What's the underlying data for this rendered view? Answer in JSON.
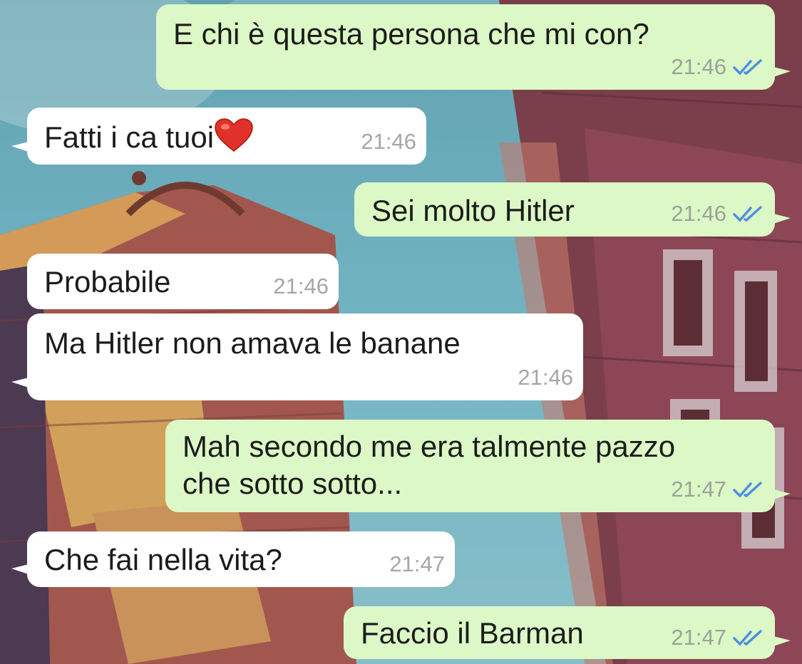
{
  "chat": {
    "messages": [
      {
        "direction": "out",
        "text": "E chi è questa persona che mi con?",
        "time": "21:46",
        "status": "read"
      },
      {
        "direction": "in",
        "text": "Fatti i ca tuoi",
        "emoji": "heart-emoji",
        "time": "21:46"
      },
      {
        "direction": "out",
        "text": "Sei molto Hitler",
        "time": "21:46",
        "status": "read"
      },
      {
        "direction": "in",
        "text": "Probabile",
        "time": "21:46"
      },
      {
        "direction": "in",
        "text": "Ma Hitler non amava le banane",
        "time": "21:46"
      },
      {
        "direction": "out",
        "text": "Mah secondo me era talmente pazzo\nche sotto sotto...",
        "time": "21:47",
        "status": "read"
      },
      {
        "direction": "in",
        "text": "Che fai nella vita?",
        "time": "21:47"
      },
      {
        "direction": "out",
        "text": "Faccio il Barman",
        "time": "21:47",
        "status": "read"
      }
    ]
  },
  "colors": {
    "outgoing_bubble": "#dcf8c6",
    "incoming_bubble": "#ffffff",
    "read_ticks": "#4f8fe0",
    "timestamp": "#9aa39a"
  }
}
